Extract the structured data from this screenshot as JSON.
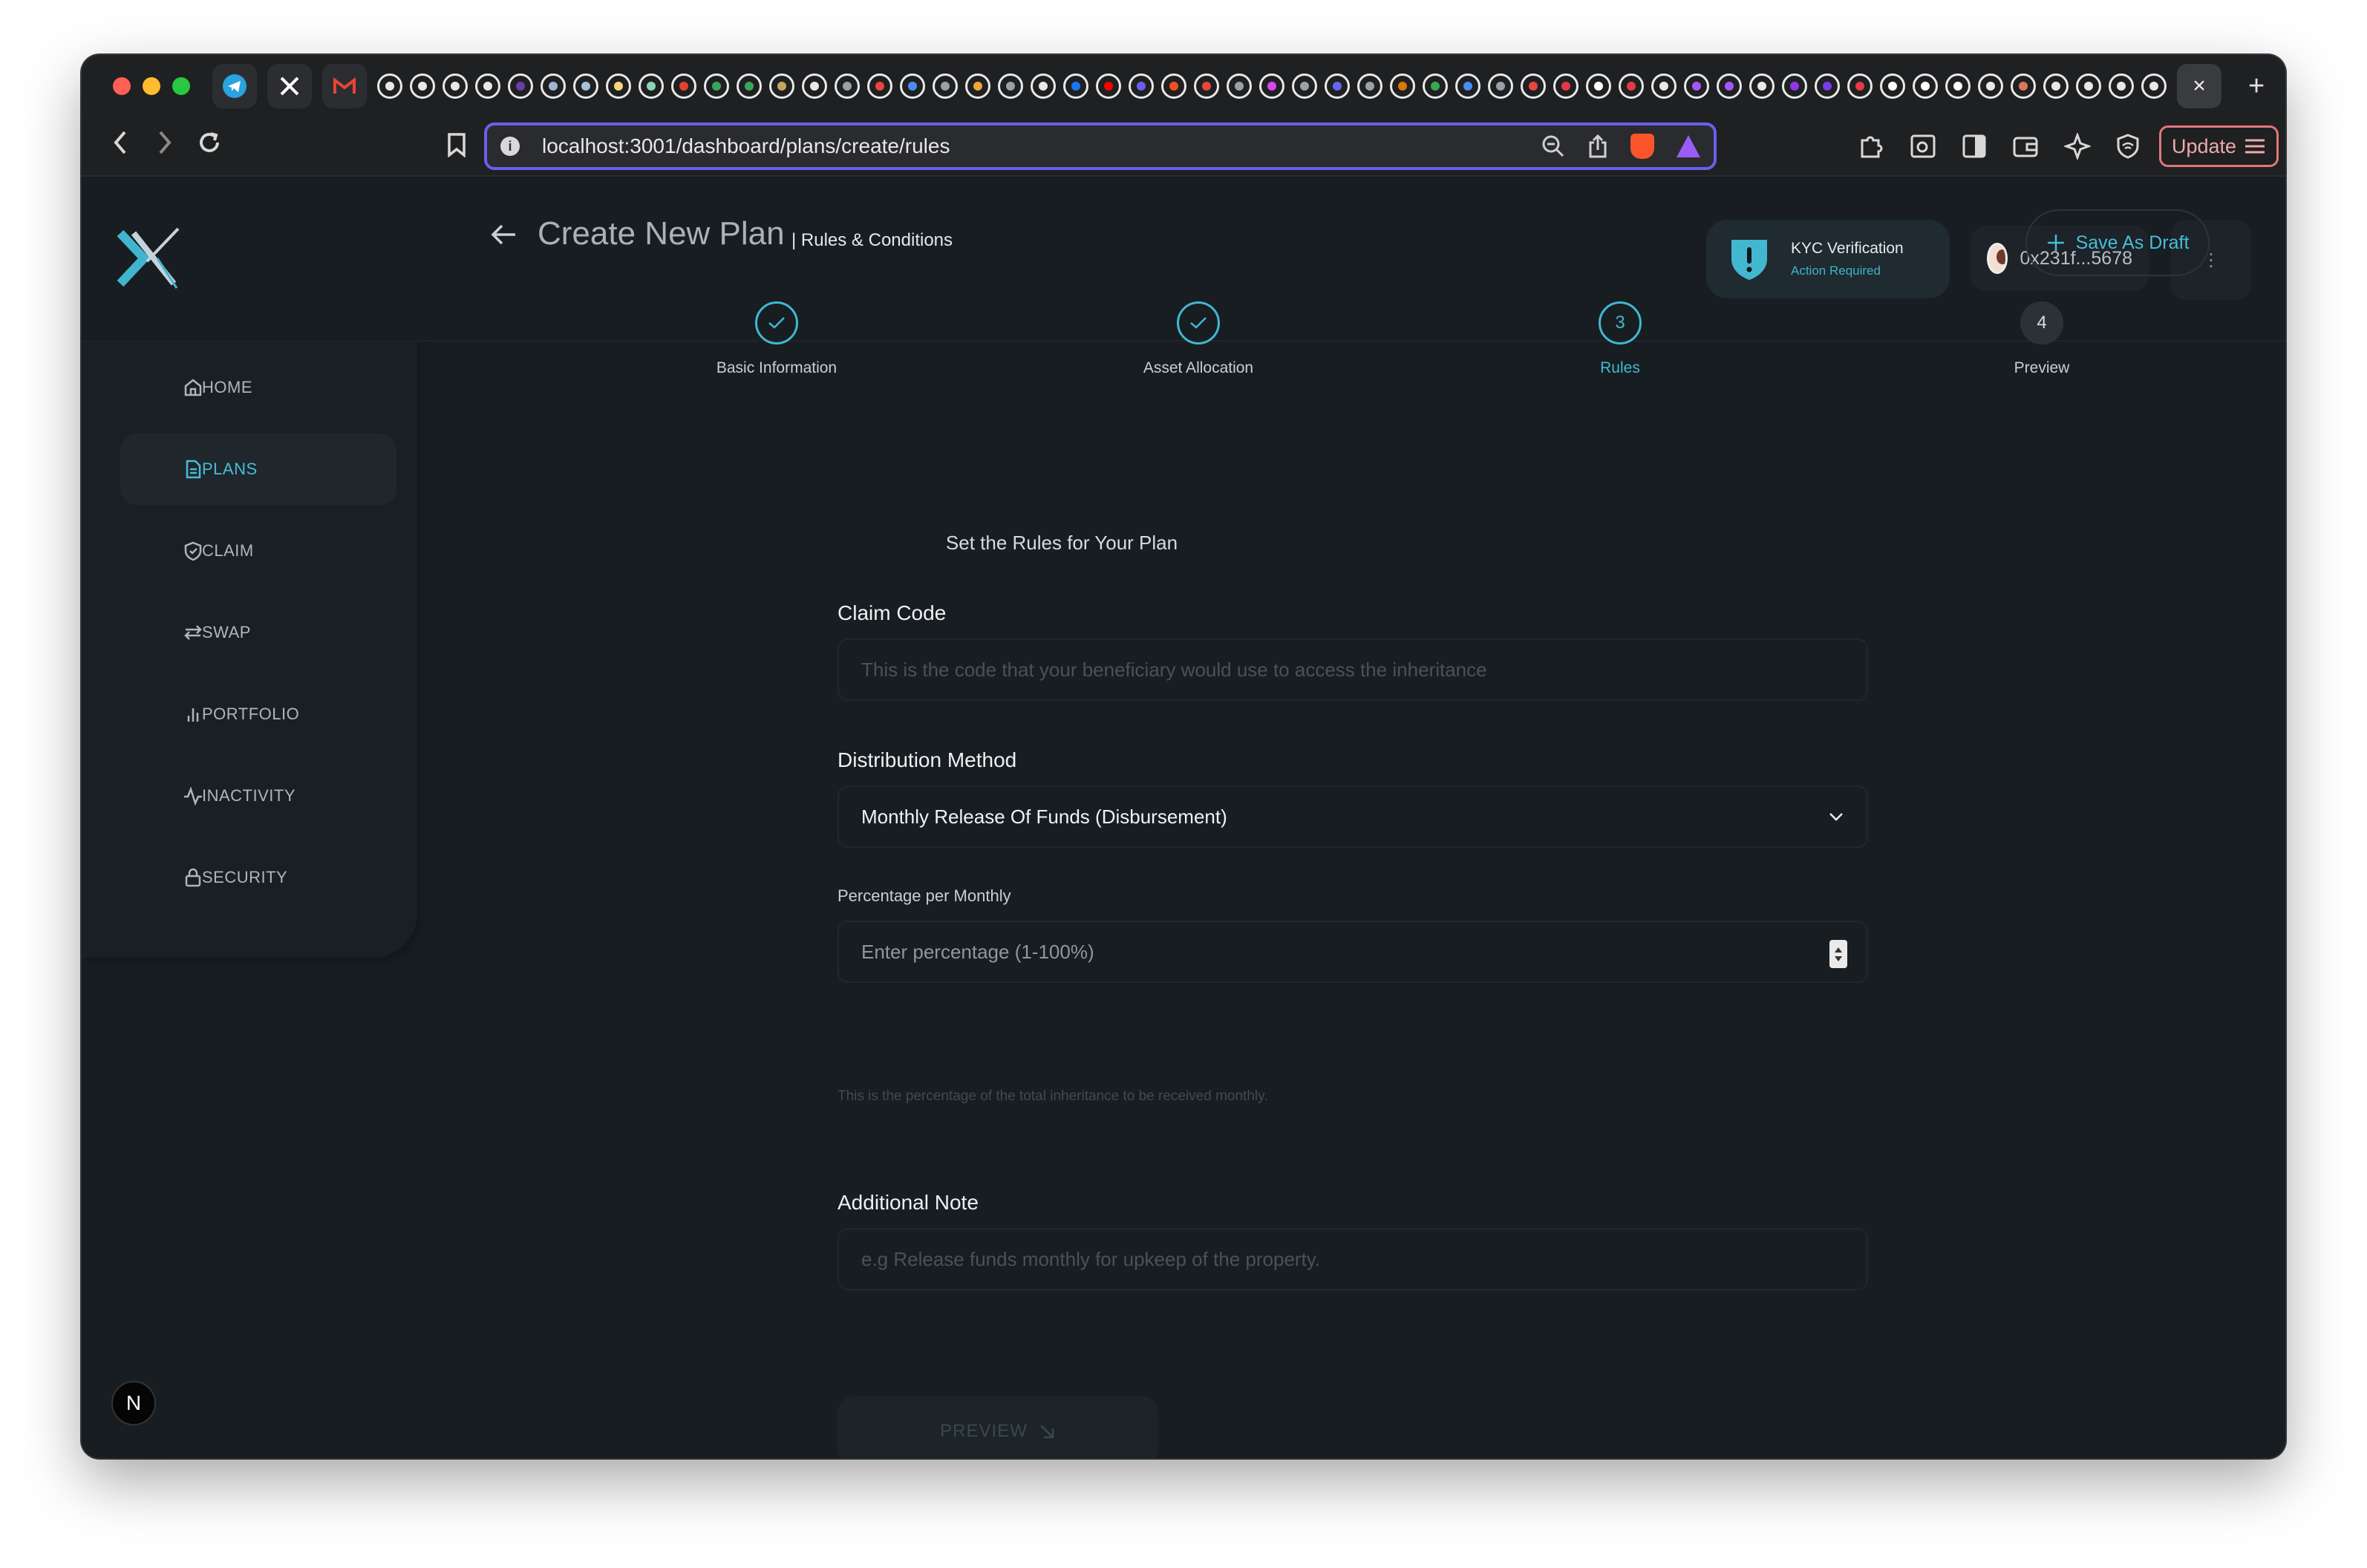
{
  "browser": {
    "url": "localhost:3001/dashboard/plans/create/rules",
    "update_label": "Update",
    "new_tab": "+",
    "close_tab": "×",
    "tab_favicon_colors": [
      "#e8e8e8",
      "#e8e8e8",
      "#e8e8e8",
      "#e8e8e8",
      "#6c3ea8",
      "#9fb6d8",
      "#9fc3e0",
      "#f5d77a",
      "#8ad6b0",
      "#e0442e",
      "#3aa757",
      "#3aa757",
      "#c8a35a",
      "#e8e8e8",
      "#9aa0a6",
      "#e8453c",
      "#4b8bf5",
      "#9aa0a6",
      "#f2a33a",
      "#9aa0a6",
      "#e8e8e8",
      "#1877f2",
      "#ff0000",
      "#6a5ef0",
      "#f24e1e",
      "#e8453c",
      "#9aa0a6",
      "#d946ef",
      "#9aa0a6",
      "#6366f1",
      "#9aa0a6",
      "#d97706",
      "#34a853",
      "#4b8bf5",
      "#9aa0a6",
      "#e8453c",
      "#e63946",
      "#ffffff",
      "#e63946",
      "#e8e8e8",
      "#a855f7",
      "#a855f7",
      "#e8e8e8",
      "#9333ea",
      "#7c3aed",
      "#e63946",
      "#ffffff",
      "#ffffff",
      "#ffffff",
      "#e8e8e8",
      "#d97757",
      "#e8e8e8",
      "#e8e8e8",
      "#e8e8e8",
      "#e8e8e8"
    ]
  },
  "header": {
    "kyc": {
      "title": "KYC Verification",
      "subtitle": "Action Required"
    },
    "wallet": {
      "address": "0x231f...5678"
    },
    "more_icon": "⋮"
  },
  "sidebar": {
    "items": [
      {
        "label": "HOME",
        "icon": "home-icon"
      },
      {
        "label": "PLANS",
        "icon": "document-icon",
        "active": true
      },
      {
        "label": "CLAIM",
        "icon": "shield-check-icon"
      },
      {
        "label": "SWAP",
        "icon": "swap-icon"
      },
      {
        "label": "PORTFOLIO",
        "icon": "bar-chart-icon"
      },
      {
        "label": "INACTIVITY",
        "icon": "activity-icon"
      },
      {
        "label": "SECURITY",
        "icon": "lock-icon"
      }
    ]
  },
  "page": {
    "title": "Create New Plan",
    "subtitle": "| Rules & Conditions",
    "save_draft": "Save As Draft"
  },
  "steps": [
    {
      "label": "Basic Information",
      "state": "done"
    },
    {
      "label": "Asset Allocation",
      "state": "done"
    },
    {
      "label": "Rules",
      "number": "3",
      "state": "active"
    },
    {
      "label": "Preview",
      "number": "4",
      "state": "todo"
    }
  ],
  "form": {
    "heading": "Set the Rules for Your Plan",
    "claim_code": {
      "label": "Claim Code",
      "placeholder": "This is the code that your beneficiary would use to access the inheritance"
    },
    "distribution": {
      "label": "Distribution Method",
      "value": "Monthly Release Of Funds (Disbursement)"
    },
    "percentage": {
      "label": "Percentage per Monthly",
      "placeholder": "Enter percentage (1-100%)",
      "helper": "This is the percentage of the total inheritance to be received monthly."
    },
    "note": {
      "label": "Additional Note",
      "placeholder": "e.g Release funds monthly for upkeep of the property."
    },
    "preview_button": "PREVIEW"
  },
  "dev_badge": "N",
  "colors": {
    "accent": "#42b9d1",
    "background": "#181d21",
    "url_focus": "#6a5ef0"
  }
}
